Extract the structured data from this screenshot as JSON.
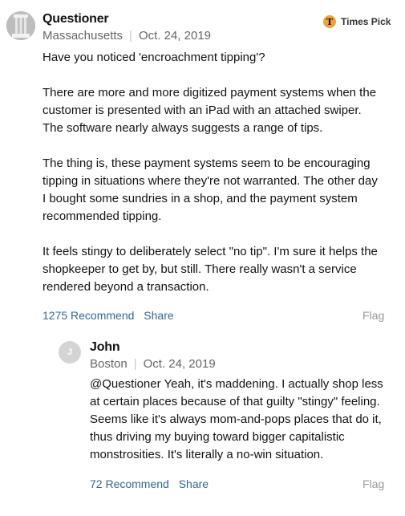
{
  "main_comment": {
    "author": "Questioner",
    "location": "Massachusetts",
    "date": "Oct. 24, 2019",
    "badge_label": "Times Pick",
    "badge_icon": "T",
    "paragraphs": [
      "Have you noticed 'encroachment tipping'?",
      "There are more and more digitized payment systems when the customer is presented with an iPad with an attached swiper. The software nearly always suggests a range of tips.",
      "The thing is, these payment systems seem to be encouraging tipping in situations where they're not warranted. The other day I bought some sundries in a shop, and the payment system recommended tipping.",
      "It feels stingy to deliberately select \"no tip\". I'm sure it helps the shopkeeper to get by, but still. There really wasn't a service rendered beyond a transaction."
    ],
    "recommend_label": "1275 Recommend",
    "share_label": "Share",
    "flag_label": "Flag"
  },
  "reply_comment": {
    "avatar_initial": "J",
    "author": "John",
    "location": "Boston",
    "date": "Oct. 24, 2019",
    "text": "@Questioner Yeah, it's maddening. I actually shop less at certain places because of that guilty \"stingy\" feeling. Seems like it's always mom-and-pops places that do it, thus driving my buying toward bigger capitalistic monstrosities. It's literally a no-win situation.",
    "recommend_label": "72 Recommend",
    "share_label": "Share",
    "flag_label": "Flag"
  },
  "colors": {
    "link": "#326891",
    "meta": "#666666",
    "badge": "#f0a23a"
  }
}
